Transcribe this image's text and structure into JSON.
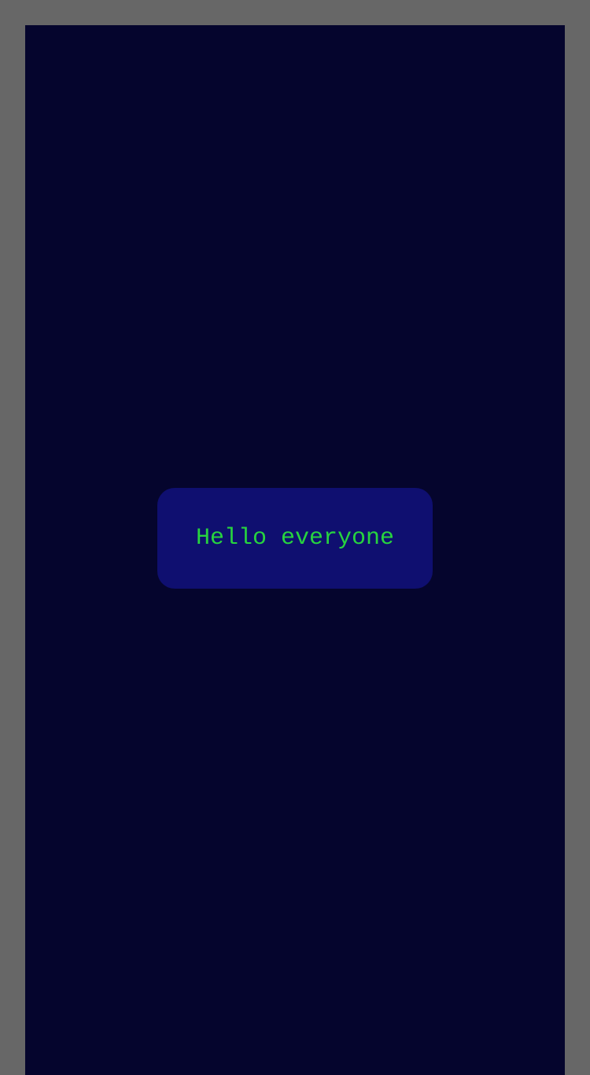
{
  "screen": {
    "message": "Hello everyone"
  },
  "colors": {
    "page_background": "#676767",
    "screen_background": "#05052d",
    "card_background": "#0f0f70",
    "text": "#27d33f"
  }
}
